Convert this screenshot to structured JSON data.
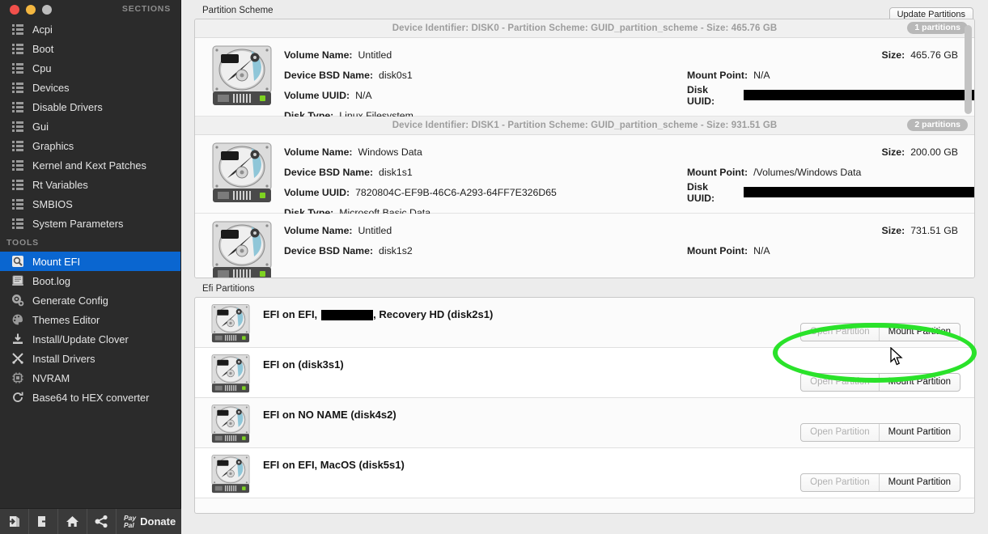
{
  "window": {
    "traffic_lights": [
      "close",
      "minimize",
      "zoom"
    ]
  },
  "sidebar": {
    "sections_header": "SECTIONS",
    "tools_header": "TOOLS",
    "sections": [
      {
        "label": "Acpi",
        "icon": "list-icon"
      },
      {
        "label": "Boot",
        "icon": "list-icon"
      },
      {
        "label": "Cpu",
        "icon": "list-icon"
      },
      {
        "label": "Devices",
        "icon": "list-icon"
      },
      {
        "label": "Disable Drivers",
        "icon": "list-icon"
      },
      {
        "label": "Gui",
        "icon": "list-icon"
      },
      {
        "label": "Graphics",
        "icon": "list-icon"
      },
      {
        "label": "Kernel and Kext Patches",
        "icon": "list-icon"
      },
      {
        "label": "Rt Variables",
        "icon": "list-icon"
      },
      {
        "label": "SMBIOS",
        "icon": "list-icon"
      },
      {
        "label": "System Parameters",
        "icon": "list-icon"
      }
    ],
    "tools": [
      {
        "label": "Mount EFI",
        "icon": "mount-efi-icon",
        "selected": true
      },
      {
        "label": "Boot.log",
        "icon": "log-icon",
        "selected": false
      },
      {
        "label": "Generate Config",
        "icon": "gear-icon",
        "selected": false
      },
      {
        "label": "Themes Editor",
        "icon": "palette-icon",
        "selected": false
      },
      {
        "label": "Install/Update Clover",
        "icon": "download-icon",
        "selected": false
      },
      {
        "label": "Install Drivers",
        "icon": "tools-icon",
        "selected": false
      },
      {
        "label": "NVRAM",
        "icon": "chip-icon",
        "selected": false
      },
      {
        "label": "Base64 to HEX converter",
        "icon": "refresh-icon",
        "selected": false
      }
    ],
    "bottom_bar": {
      "buttons": [
        {
          "name": "import-icon"
        },
        {
          "name": "export-icon"
        },
        {
          "name": "home-icon"
        },
        {
          "name": "share-icon"
        }
      ],
      "paypal_line1": "Pay",
      "paypal_line2": "Pal",
      "donate_label": "Donate"
    },
    "accent_color": "#0a66d0",
    "background_color": "#2b2b2b"
  },
  "main": {
    "partition_scheme_label": "Partition Scheme",
    "update_partitions_label": "Update Partitions",
    "efi_partitions_label": "Efi Partitions",
    "field_labels": {
      "volume_name": "Volume Name:",
      "device_bsd_name": "Device BSD Name:",
      "volume_uuid": "Volume UUID:",
      "disk_type": "Disk Type:",
      "size": "Size:",
      "mount_point": "Mount Point:",
      "disk_uuid": "Disk UUID:"
    },
    "disks": [
      {
        "header": "Device Identifier: DISK0 - Partition Scheme: GUID_partition_scheme - Size: 465.76 GB",
        "partitions_badge": "1 partitions",
        "volume_name": "Untitled",
        "device_bsd_name": "disk0s1",
        "volume_uuid": "N/A",
        "disk_type": "Linux Filesystem",
        "size": "465.76 GB",
        "mount_point": "N/A",
        "disk_uuid_redacted": true,
        "disk_uuid_redaction_width": 285
      },
      {
        "header": "Device Identifier: DISK1 - Partition Scheme: GUID_partition_scheme - Size: 931.51 GB",
        "partitions_badge": "2 partitions",
        "volume_name": "Windows Data",
        "device_bsd_name": "disk1s1",
        "volume_uuid": "7820804C-EF9B-46C6-A293-64FF7E326D65",
        "disk_type": "Microsoft Basic Data",
        "size": "200.00 GB",
        "mount_point": "/Volumes/Windows Data",
        "disk_uuid_redacted": true,
        "disk_uuid_redaction_width": 290
      },
      {
        "header": null,
        "partitions_badge": null,
        "volume_name": "Untitled",
        "device_bsd_name": "disk1s2",
        "volume_uuid": null,
        "disk_type": null,
        "size": "731.51 GB",
        "mount_point": "N/A",
        "disk_uuid_redacted": false,
        "disk_uuid_redaction_width": 0
      }
    ],
    "efi_rows": [
      {
        "title_before": "EFI on EFI,",
        "title_redacted": true,
        "title_after": ", Recovery HD (disk2s1)",
        "open_label": "Open Partition",
        "mount_label": "Mount Partition",
        "highlighted": true
      },
      {
        "title_before": "EFI on  (disk3s1)",
        "title_redacted": false,
        "title_after": "",
        "open_label": "Open Partition",
        "mount_label": "Mount Partition",
        "highlighted": false
      },
      {
        "title_before": "EFI on NO NAME (disk4s2)",
        "title_redacted": false,
        "title_after": "",
        "open_label": "Open Partition",
        "mount_label": "Mount Partition",
        "highlighted": false
      },
      {
        "title_before": "EFI on EFI, MacOS (disk5s1)",
        "title_redacted": false,
        "title_after": "",
        "open_label": "Open Partition",
        "mount_label": "Mount Partition",
        "highlighted": false
      }
    ],
    "annotation": {
      "shape": "ellipse",
      "color": "#2ae22a"
    }
  }
}
